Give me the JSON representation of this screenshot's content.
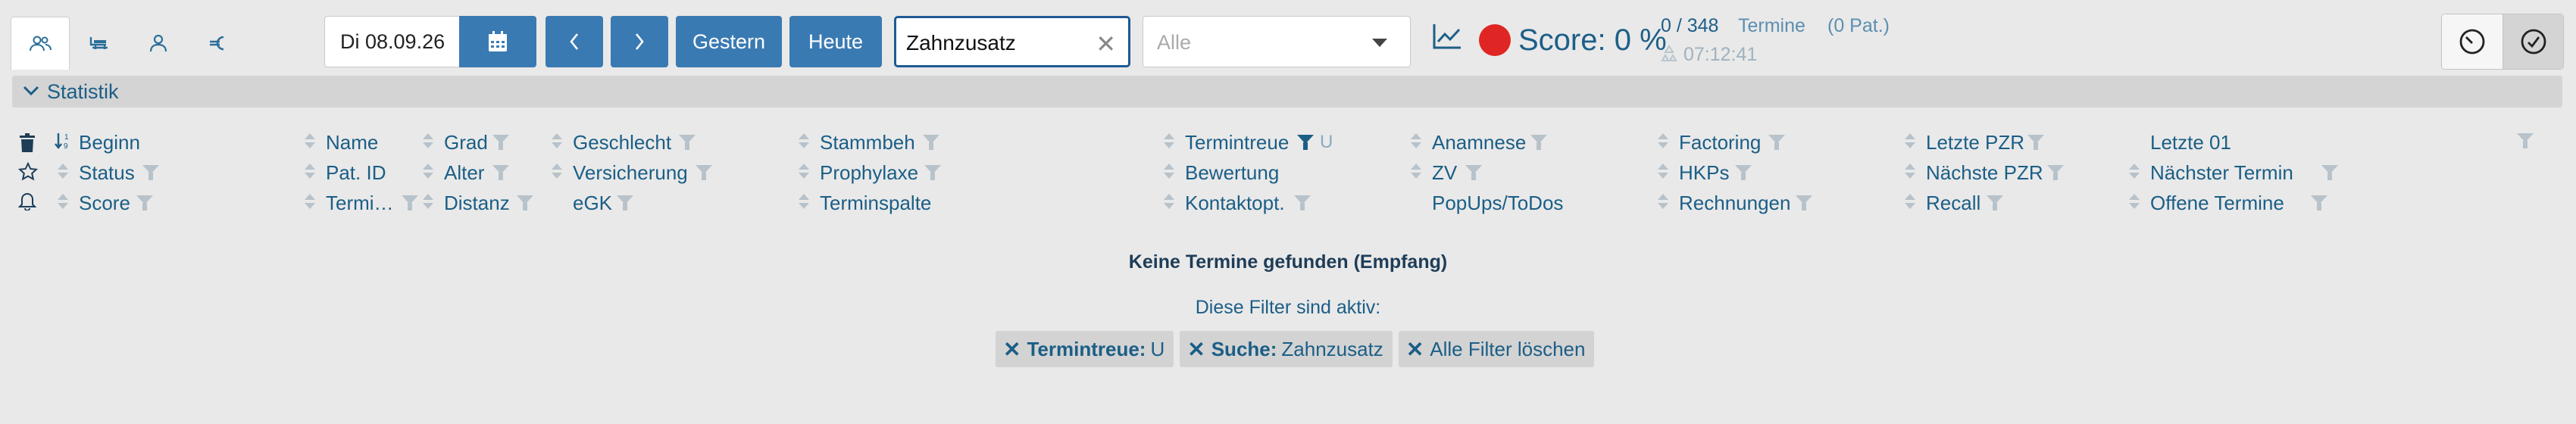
{
  "toolbar": {
    "tabs": [
      {
        "icon": "people-icon"
      },
      {
        "icon": "chair-icon"
      },
      {
        "icon": "person-icon"
      },
      {
        "icon": "euro-icon"
      }
    ],
    "date_value": "Di 08.09.26",
    "gestern_label": "Gestern",
    "heute_label": "Heute",
    "search_value": "Zahnzusatz",
    "select_placeholder": "Alle",
    "score_label": "Score: 0 %",
    "termine_count": "0 / 348",
    "termine_word": "Termine",
    "pat_count": "(0 Pat.)",
    "clock_time": "07:12:41",
    "accent": "#3a7ab2",
    "score_color": "#e02525"
  },
  "statistik": {
    "label": "Statistik"
  },
  "columns": {
    "beginn": "Beginn",
    "status": "Status",
    "score": "Score",
    "name": "Name",
    "pat_id": "Pat. ID",
    "termi": "Termi…",
    "grad": "Grad",
    "alter": "Alter",
    "distanz": "Distanz",
    "geschlecht": "Geschlecht",
    "versicherung": "Versicherung",
    "egk": "eGK",
    "stammbeh": "Stammbeh",
    "prophylaxe": "Prophylaxe",
    "terminspalte": "Terminspalte",
    "termintreue": "Termintreue",
    "termintreue_value": "U",
    "bewertung": "Bewertung",
    "kontaktopt": "Kontaktopt.",
    "anamnese": "Anamnese",
    "zv": "ZV",
    "popups": "PopUps/ToDos",
    "factoring": "Factoring",
    "hkps": "HKPs",
    "rechnungen": "Rechnungen",
    "letzte_pzr": "Letzte PZR",
    "naechste_pzr": "Nächste PZR",
    "recall": "Recall",
    "letzte_01": "Letzte 01",
    "naechster_termin": "Nächster Termin",
    "offene_termine": "Offene Termine"
  },
  "empty": {
    "title": "Keine Termine gefunden (Empfang)",
    "filter_note": "Diese Filter sind aktiv:",
    "chips": [
      {
        "key": "Termintreue:",
        "value": "U"
      },
      {
        "key": "Suche:",
        "value": "Zahnzusatz"
      },
      {
        "key": "",
        "value": "Alle Filter löschen"
      }
    ]
  }
}
